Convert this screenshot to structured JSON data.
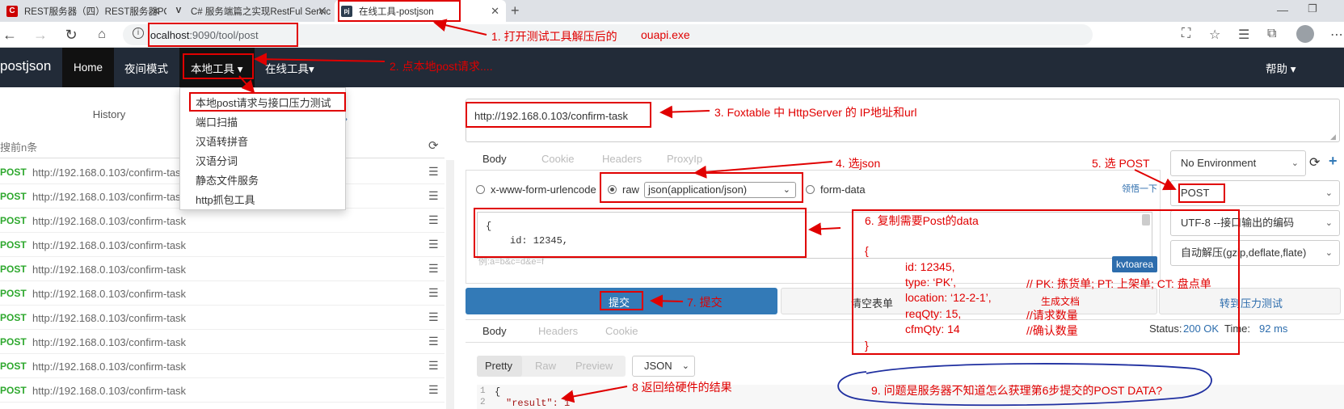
{
  "browser": {
    "tabs": [
      {
        "title": "REST服务器（四）REST服务器PO",
        "favicon": "C"
      },
      {
        "title": "C# 服务端篇之实现RestFul Servic",
        "favicon": "V"
      },
      {
        "title": "在线工具-postjson",
        "favicon": "pj"
      }
    ],
    "new_tab_icon": "plus-icon",
    "url_host": "localhost",
    "url_rest": ":9090/tool/post"
  },
  "navbar": {
    "brand": "postjson",
    "items": [
      "Home",
      "夜间模式",
      "本地工具 ▾",
      "在线工具▾"
    ],
    "help": "帮助 ▾"
  },
  "dropdown": {
    "items": [
      "本地post请求与接口压力测试",
      "端口扫描",
      "汉语转拼音",
      "汉语分词",
      "静态文件服务",
      "http抓包工具"
    ]
  },
  "history": {
    "tab_label": "History",
    "search_placeholder": "搜前n条",
    "rows": [
      {
        "method": "POST",
        "url": "http://192.168.0.103/confirm-task"
      },
      {
        "method": "POST",
        "url": "http://192.168.0.103/confirm-task"
      },
      {
        "method": "POST",
        "url": "http://192.168.0.103/confirm-task"
      },
      {
        "method": "POST",
        "url": "http://192.168.0.103/confirm-task"
      },
      {
        "method": "POST",
        "url": "http://192.168.0.103/confirm-task"
      },
      {
        "method": "POST",
        "url": "http://192.168.0.103/confirm-task"
      },
      {
        "method": "POST",
        "url": "http://192.168.0.103/confirm-task"
      },
      {
        "method": "POST",
        "url": "http://192.168.0.103/confirm-task"
      },
      {
        "method": "POST",
        "url": "http://192.168.0.103/confirm-task"
      },
      {
        "method": "POST",
        "url": "http://192.168.0.103/confirm-task"
      }
    ]
  },
  "request": {
    "url": "http://192.168.0.103/confirm-task",
    "tabs": [
      "Body",
      "Cookie",
      "Headers",
      "ProxyIp"
    ],
    "opt_urlencoded": "x-www-form-urlencode",
    "opt_raw": "raw",
    "content_type": "json(application/json)",
    "opt_formdata": "form-data",
    "help_link": "领悟一下",
    "editor_line1": "{",
    "editor_line2": "id: 12345,",
    "editor_hint": "例:a=b&c=d&e=f",
    "kvtoarea": "kvtoarea",
    "environment": "No Environment",
    "method": "POST",
    "encoding": "UTF-8 --接口输出的编码",
    "decompress": "自动解压(gzip,deflate,flate)",
    "submit": "提交",
    "clear": "清空表单",
    "gen_doc": "生成文档",
    "stress": "转到压力测试"
  },
  "response": {
    "tabs": [
      "Body",
      "Headers",
      "Cookie"
    ],
    "status_label": "Status:",
    "status_value": "200 OK",
    "time_label": "Time:",
    "time_value": "92 ms",
    "views": [
      "Pretty",
      "Raw",
      "Preview"
    ],
    "format": "JSON",
    "line1_no": "1",
    "line2_no": "2",
    "line1": "{",
    "line2": "\"result\": 1"
  },
  "annotations": {
    "a1": "1. 打开测试工具解压后的",
    "a1_file": "ouapi.exe",
    "a2": "2. 点本地post请求....",
    "a3": "3. Foxtable 中 HttpServer 的 IP地址和url",
    "a4": "4. 选json",
    "a5": "5. 选 POST",
    "a6": "6. 复制需要Post的data",
    "a6_open": "{",
    "a6_l1": "id: 12345,",
    "a6_l2": "type: ‘PK’,",
    "a6_l2c": "// PK: 拣货单; PT: 上架单; CT: 盘点单",
    "a6_l3": "location: ‘12-2-1’,",
    "a6_l4": "reqQty: 15,",
    "a6_l4c": "//请求数量",
    "a6_l5": "cfmQty: 14",
    "a6_l5c": "//确认数量",
    "a6_close": "}",
    "a7": "7. 提交",
    "a8": "8 返回给硬件的结果",
    "a9": "9. 问题是服务器不知道怎么获理第6步提交的POST DATA?"
  },
  "colors": {
    "navbar": "#222b38",
    "primary": "#337ab7",
    "annotation": "#e00000",
    "post_method": "#2ea82e",
    "question_circle": "#1f2fa0"
  }
}
